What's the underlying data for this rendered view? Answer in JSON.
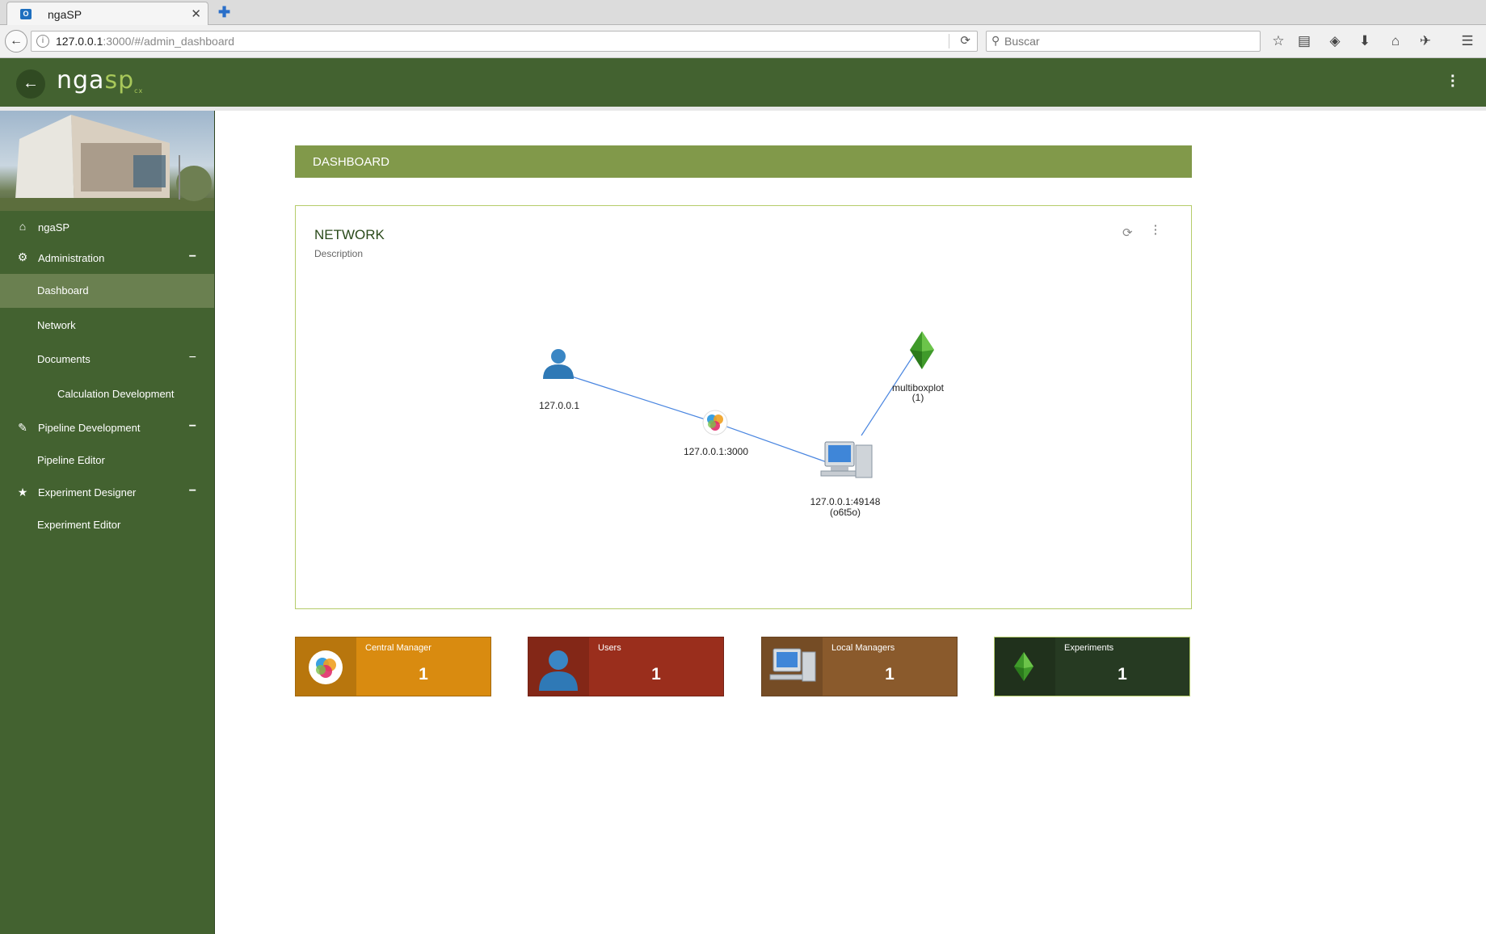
{
  "browser": {
    "tab_title": "ngaSP",
    "url_host": "127.0.0.1",
    "url_path": ":3000/#/admin_dashboard",
    "search_placeholder": "Buscar"
  },
  "header": {
    "logo_main": "nga",
    "logo_accent": "sp",
    "logo_suffix": "cx"
  },
  "sidebar": {
    "items": [
      {
        "label": "ngaSP"
      },
      {
        "label": "Administration",
        "toggle": "−"
      },
      {
        "label": "Dashboard"
      },
      {
        "label": "Network"
      },
      {
        "label": "Documents",
        "toggle": "−"
      },
      {
        "label": "Calculation Development"
      },
      {
        "label": "Pipeline Development",
        "toggle": "−"
      },
      {
        "label": "Pipeline Editor"
      },
      {
        "label": "Experiment Designer",
        "toggle": "−"
      },
      {
        "label": "Experiment Editor"
      }
    ]
  },
  "main": {
    "section_title": "DASHBOARD",
    "network_card": {
      "title": "NETWORK",
      "description": "Description"
    },
    "network_nodes": {
      "user": "127.0.0.1",
      "central": "127.0.0.1:3000",
      "local_1": "127.0.0.1:49148",
      "local_2": "(o6t5o)",
      "experiment_1": "multiboxplot",
      "experiment_2": "(1)"
    },
    "stats": [
      {
        "label": "Central Manager",
        "value": "1",
        "color": "#d98b10"
      },
      {
        "label": "Users",
        "value": "1",
        "color": "#9a2e1c"
      },
      {
        "label": "Local Managers",
        "value": "1",
        "color": "#8a5a2c"
      },
      {
        "label": "Experiments",
        "value": "1",
        "color": "#263a22"
      }
    ]
  },
  "colors": {
    "header_green": "#436230",
    "dashboard_bar": "#81994a",
    "link_line": "#4a86e0"
  }
}
